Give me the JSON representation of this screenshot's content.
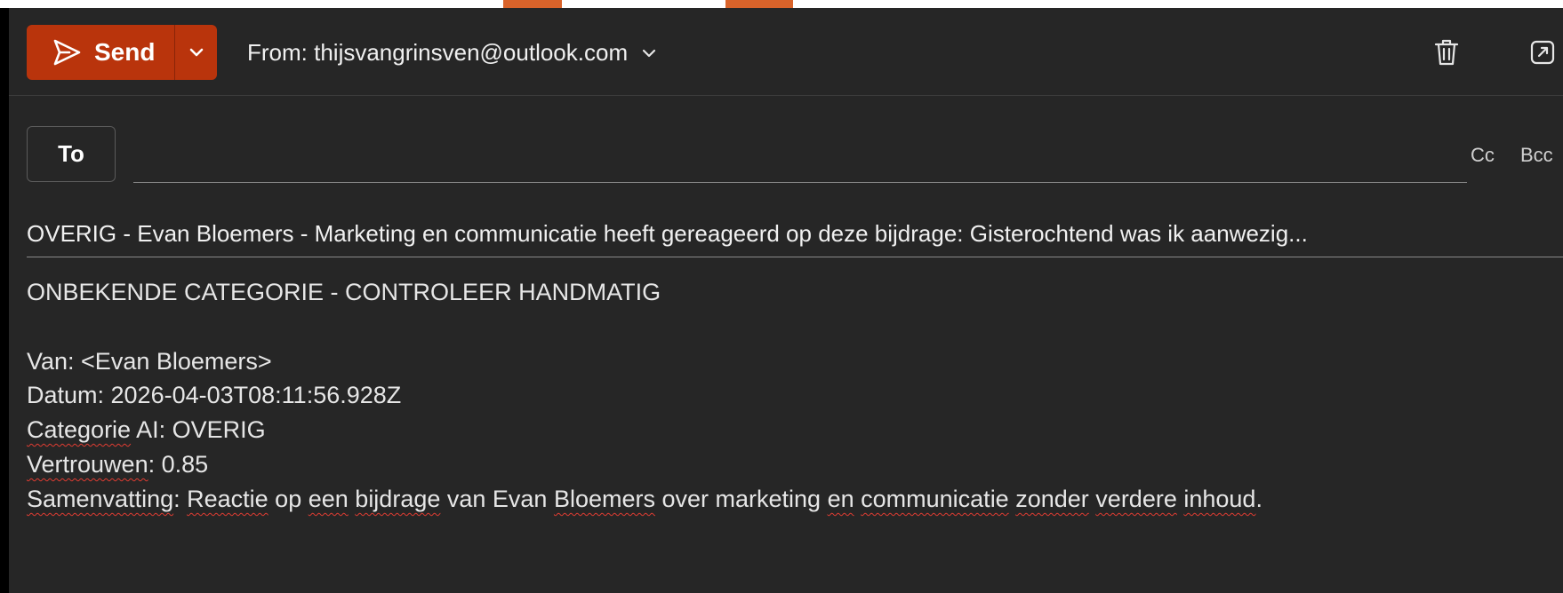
{
  "toolbar": {
    "send_label": "Send",
    "from_label": "From: thijsvangrinsven@outlook.com",
    "icons": [
      "send-icon",
      "chevron-down-icon",
      "trash-icon",
      "popout-icon"
    ]
  },
  "recipients": {
    "to_label": "To",
    "cc_label": "Cc",
    "bcc_label": "Bcc",
    "to_value": ""
  },
  "subject": "OVERIG - Evan Bloemers - Marketing en communicatie heeft gereageerd op deze bijdrage: Gisterochtend was ik aanwezig...",
  "body": {
    "heading": "ONBEKENDE CATEGORIE - CONTROLEER HANDMATIG",
    "van": "Van:  <Evan Bloemers>",
    "datum": "Datum: 2026-04-03T08:11:56.928Z",
    "categorie_word": "Categorie",
    "categorie_rest": " AI: OVERIG",
    "vertrouwen_word": "Vertrouwen",
    "vertrouwen_rest": ": 0.85",
    "samenvatting": {
      "w1": "Samenvatting",
      "t1": ": ",
      "w2": "Reactie",
      "t2": " op ",
      "w3": "een",
      "t3": " ",
      "w4": "bijdrage",
      "t4": " van Evan ",
      "w5": "Bloemers",
      "t5": " over marketing ",
      "w6": "en",
      "t6": " ",
      "w7": "communicatie",
      "t7": " ",
      "w8": "zonder",
      "t8": " ",
      "w9": "verdere",
      "t9": " ",
      "w10": "inhoud",
      "t10": "."
    }
  },
  "colors": {
    "send_button": "#b9340c",
    "pane_background": "#262626",
    "spellcheck": "#e03c32"
  }
}
